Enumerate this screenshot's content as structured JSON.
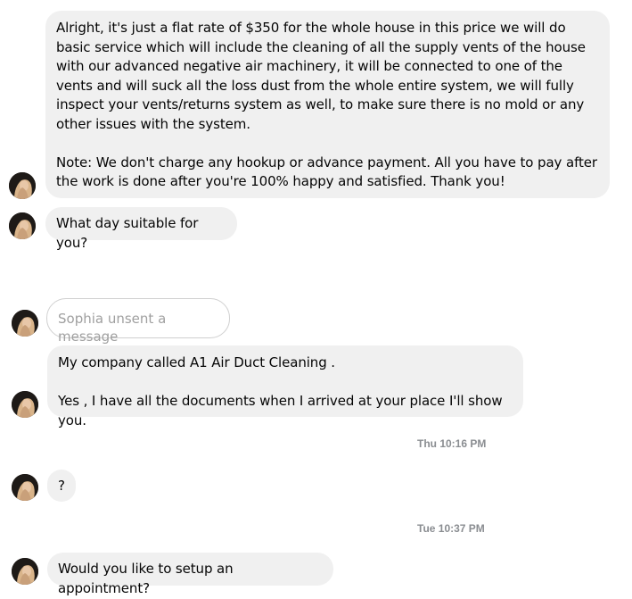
{
  "conversation": {
    "sender": "Sophia",
    "messages": [
      {
        "paragraphs": [
          "Alright, it's just a flat rate of $350 for the whole house in this price we will do basic service which will include the cleaning of all the supply vents of the house with our advanced negative air machinery, it will be connected to one of the vents and will suck all the loss dust from the whole entire system, we will fully inspect your vents/returns system as well, to make sure there is no mold or any other issues with the system.",
          "Note: We don't charge any hookup or advance payment. All you have to pay after the work is done after you're 100% happy and satisfied. Thank you!"
        ]
      },
      {
        "text": "What day suitable for you?"
      },
      {
        "unsent_text": "Sophia unsent a message"
      },
      {
        "paragraphs": [
          "My company called A1 Air Duct Cleaning .",
          "Yes , I have all the documents when I arrived at your place I'll show you."
        ]
      },
      {
        "timestamp": "Thu 10:16 PM"
      },
      {
        "text": "?"
      },
      {
        "timestamp": "Tue 10:37 PM"
      },
      {
        "text": "Would you like to setup an appointment?"
      }
    ]
  },
  "icons": {
    "avatar": "profile-photo-icon"
  }
}
